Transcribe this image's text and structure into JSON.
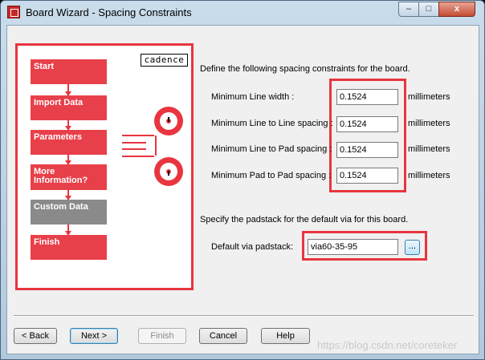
{
  "window": {
    "title": "Board Wizard - Spacing Constraints",
    "minimize": "–",
    "maximize": "□",
    "close": "x"
  },
  "left_panel": {
    "logo": "cadence",
    "steps": [
      {
        "label": "Start",
        "state": "done"
      },
      {
        "label": "Import Data",
        "state": "done"
      },
      {
        "label": "Parameters",
        "state": "done"
      },
      {
        "label": "More\nInformation?",
        "state": "done"
      },
      {
        "label": "Custom Data",
        "state": "current"
      },
      {
        "label": "Finish",
        "state": "pending"
      }
    ]
  },
  "spacing": {
    "intro": "Define the following spacing constraints for the board.",
    "rows": [
      {
        "label": "Minimum Line width :",
        "value": "0.1524",
        "unit": "millimeters"
      },
      {
        "label": "Minimum Line to Line spacing :",
        "value": "0.1524",
        "unit": "millimeters"
      },
      {
        "label": "Minimum Line to Pad spacing :",
        "value": "0.1524",
        "unit": "millimeters"
      },
      {
        "label": "Minimum Pad to Pad spacing :",
        "value": "0.1524",
        "unit": "millimeters"
      }
    ]
  },
  "padstack": {
    "intro": "Specify the padstack for the default via for this board.",
    "label": "Default via padstack:",
    "value": "via60-35-95",
    "browse_label": "..."
  },
  "buttons": {
    "back": "< Back",
    "next": "Next >",
    "finish": "Finish",
    "cancel": "Cancel",
    "help": "Help"
  },
  "watermark": "https://blog.csdn.net/coreteker",
  "colors": {
    "highlight_red": "#e8353f",
    "step_current": "#8a8a8a"
  }
}
